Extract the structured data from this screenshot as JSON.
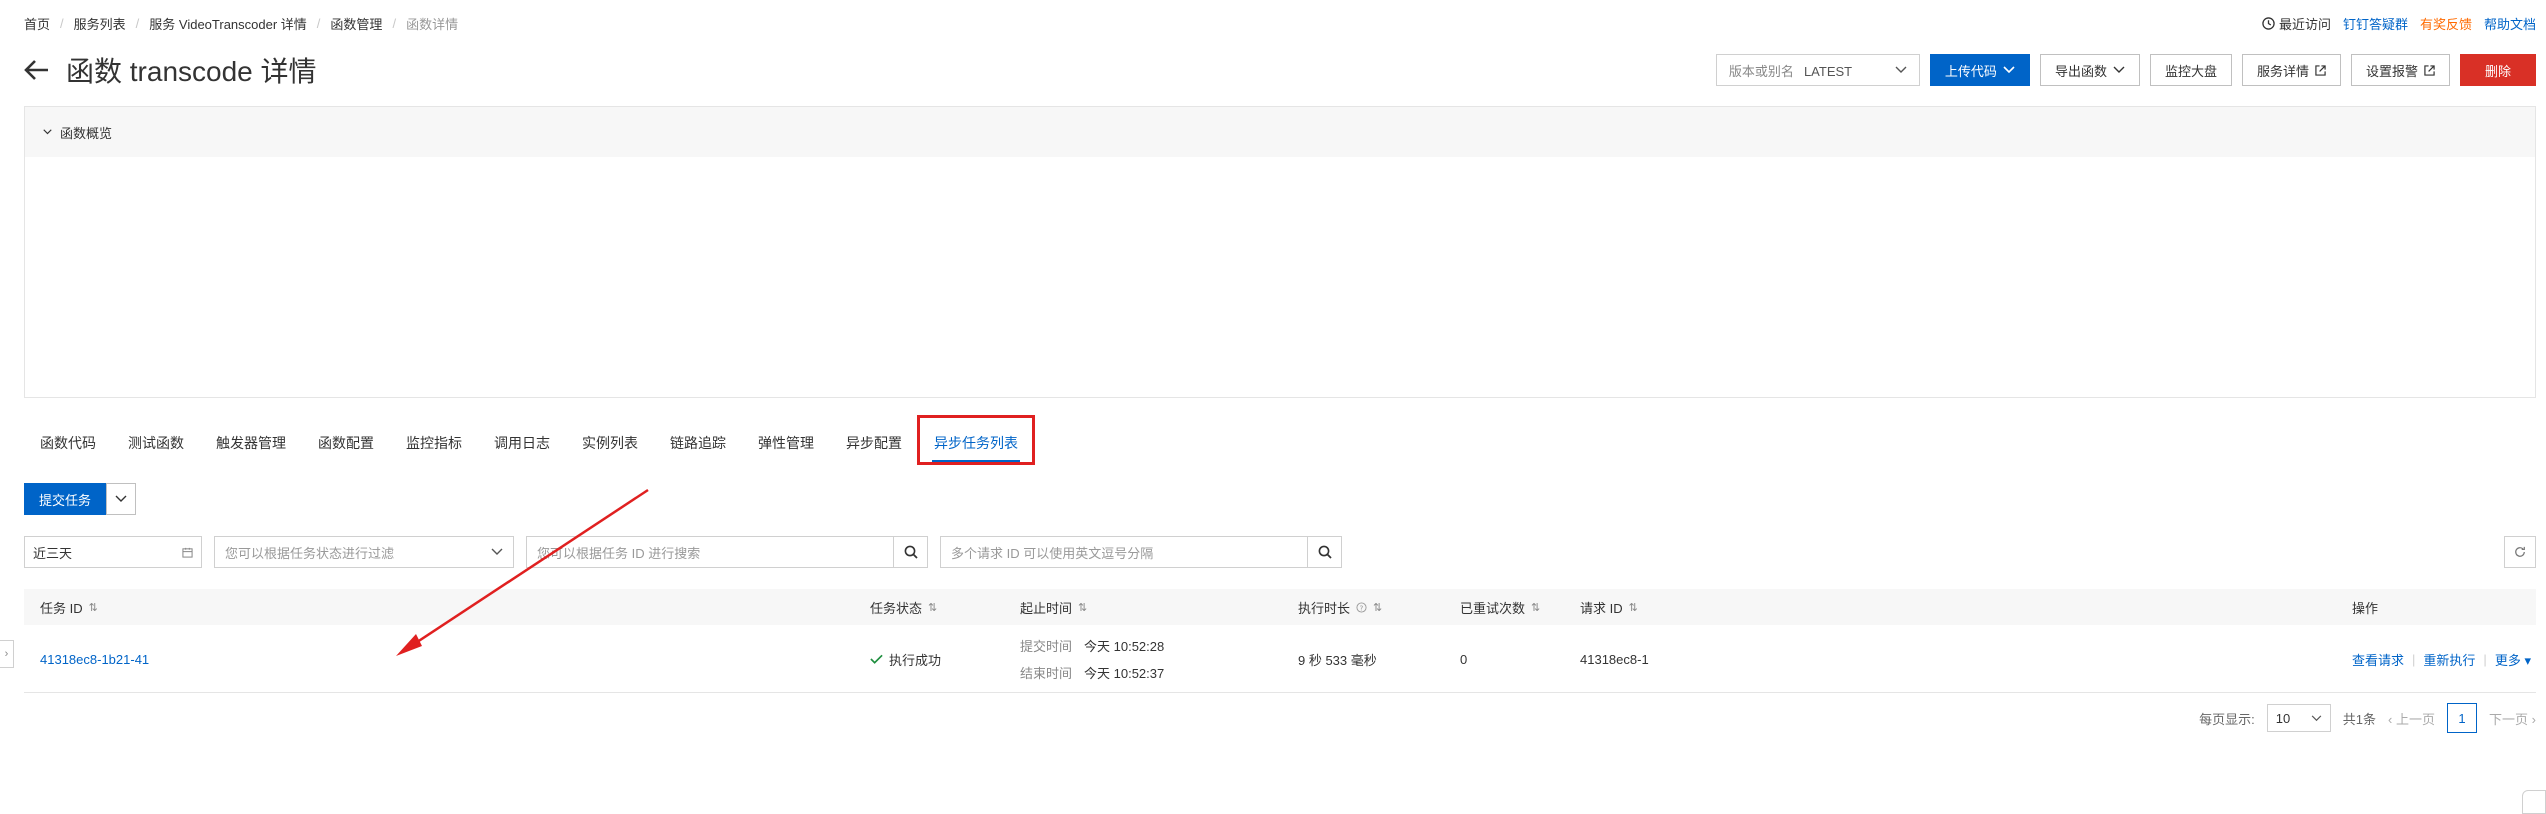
{
  "breadcrumb": [
    "首页",
    "服务列表",
    "服务 VideoTranscoder 详情",
    "函数管理",
    "函数详情"
  ],
  "top_links": {
    "recent": "最近访问",
    "dingtalk": "钉钉答疑群",
    "feedback": "有奖反馈",
    "docs": "帮助文档"
  },
  "title": "函数 transcode 详情",
  "version_select": {
    "label": "版本或别名",
    "value": "LATEST"
  },
  "actions": {
    "upload": "上传代码",
    "export": "导出函数",
    "monitor": "监控大盘",
    "service_detail": "服务详情",
    "alarm": "设置报警",
    "delete": "删除"
  },
  "overview": {
    "title": "函数概览"
  },
  "tabs": [
    "函数代码",
    "测试函数",
    "触发器管理",
    "函数配置",
    "监控指标",
    "调用日志",
    "实例列表",
    "链路追踪",
    "弹性管理",
    "异步配置",
    "异步任务列表"
  ],
  "submit": "提交任务",
  "filters": {
    "date": "近三天",
    "status_placeholder": "您可以根据任务状态进行过滤",
    "task_search_placeholder": "您可以根据任务 ID 进行搜索",
    "request_search_placeholder": "多个请求 ID 可以使用英文逗号分隔"
  },
  "table": {
    "headers": {
      "task_id": "任务 ID",
      "status": "任务状态",
      "time": "起止时间",
      "duration": "执行时长",
      "retries": "已重试次数",
      "request_id": "请求 ID",
      "ops": "操作"
    },
    "row": {
      "task_id": "41318ec8-1b21-41",
      "status": "执行成功",
      "submit_label": "提交时间",
      "submit_time": "今天 10:52:28",
      "end_label": "结束时间",
      "end_time": "今天 10:52:37",
      "duration": "9 秒 533 毫秒",
      "retries": "0",
      "request_id": "41318ec8-1",
      "op_view": "查看请求",
      "op_rerun": "重新执行",
      "op_more": "更多"
    }
  },
  "pager": {
    "page_size_label": "每页显示:",
    "page_size": "10",
    "total": "共1条",
    "prev": "上一页",
    "page": "1",
    "next": "下一页"
  },
  "colors": {
    "accent": "#0064c8",
    "danger": "#d93026",
    "annotation": "#e02020"
  }
}
